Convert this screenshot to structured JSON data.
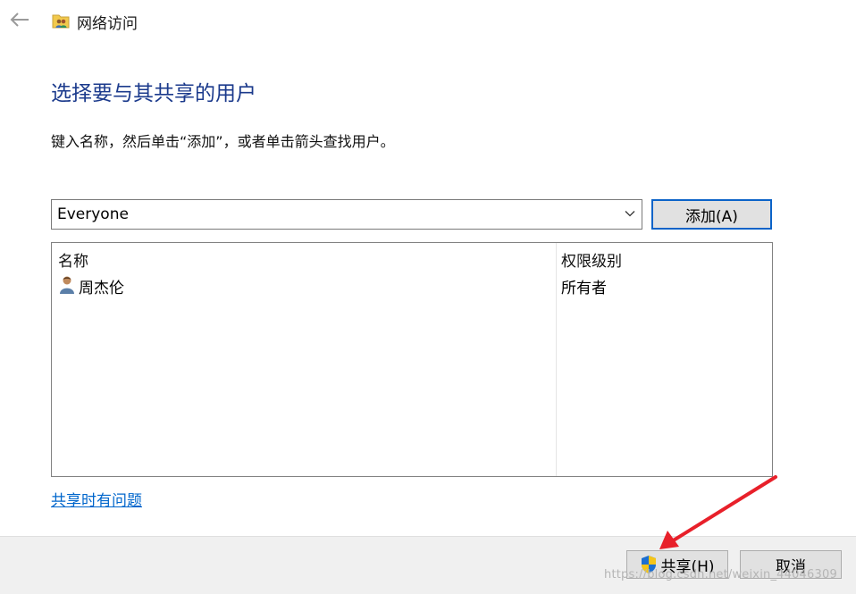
{
  "window": {
    "title": "网络访问"
  },
  "main": {
    "heading": "选择要与其共享的用户",
    "instruction": "键入名称，然后单击“添加”，或者单击箭头查找用户。"
  },
  "user_picker": {
    "value": "Everyone",
    "add_label": "添加(A)"
  },
  "list": {
    "columns": [
      "名称",
      "权限级别"
    ],
    "rows": [
      {
        "name": "周杰伦",
        "permission": "所有者",
        "icon": "user-icon"
      }
    ]
  },
  "help_link": "共享时有问题",
  "footer": {
    "share_label": "共享(H)",
    "cancel_label": "取消"
  },
  "annotation": {
    "arrow_color": "#e8202a"
  },
  "watermark": "https://blog.csdn.net/weixin_44046309",
  "colors": {
    "heading": "#1b3a8c",
    "link": "#0066cc",
    "focus_border": "#0b63c8"
  }
}
